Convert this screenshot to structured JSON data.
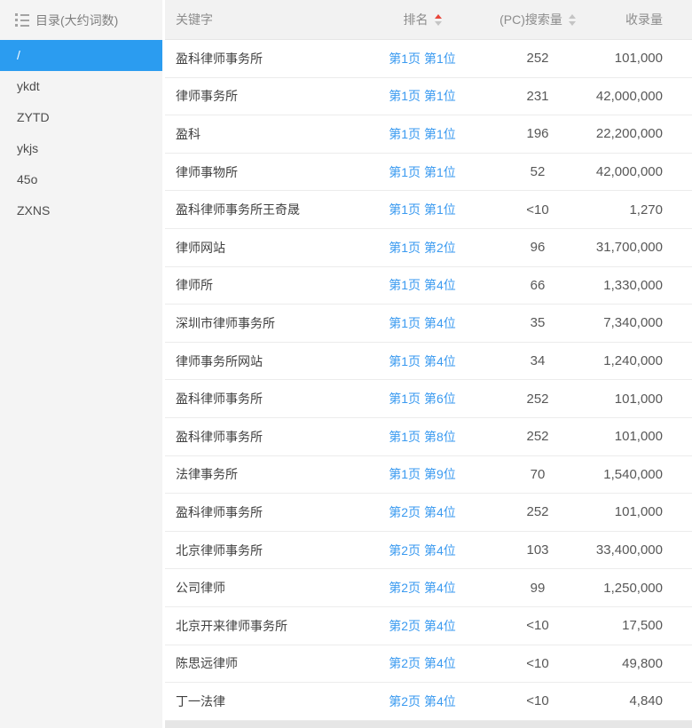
{
  "sidebar": {
    "header": {
      "label": "目录(大约词数)",
      "icon": "list-icon"
    },
    "items": [
      {
        "label": "/",
        "selected": true
      },
      {
        "label": "ykdt",
        "selected": false
      },
      {
        "label": "ZYTD",
        "selected": false
      },
      {
        "label": "ykjs",
        "selected": false
      },
      {
        "label": "45o",
        "selected": false
      },
      {
        "label": "ZXNS",
        "selected": false
      }
    ]
  },
  "table": {
    "columns": {
      "keyword": {
        "label": "关键字",
        "sortable": false
      },
      "rank": {
        "label": "排名",
        "sortable": true,
        "sort": "asc"
      },
      "pc": {
        "label": "(PC)搜索量",
        "sortable": true,
        "sort": "none"
      },
      "index": {
        "label": "收录量",
        "sortable": false
      }
    },
    "rows": [
      {
        "keyword": "盈科律师事务所",
        "rank": "第1页 第1位",
        "pc": "252",
        "index": "101,000"
      },
      {
        "keyword": "律师事务所",
        "rank": "第1页 第1位",
        "pc": "231",
        "index": "42,000,000"
      },
      {
        "keyword": "盈科",
        "rank": "第1页 第1位",
        "pc": "196",
        "index": "22,200,000"
      },
      {
        "keyword": "律师事物所",
        "rank": "第1页 第1位",
        "pc": "52",
        "index": "42,000,000"
      },
      {
        "keyword": "盈科律师事务所王奇晟",
        "rank": "第1页 第1位",
        "pc": "<10",
        "index": "1,270"
      },
      {
        "keyword": "律师网站",
        "rank": "第1页 第2位",
        "pc": "96",
        "index": "31,700,000"
      },
      {
        "keyword": "律师所",
        "rank": "第1页 第4位",
        "pc": "66",
        "index": "1,330,000"
      },
      {
        "keyword": "深圳市律师事务所",
        "rank": "第1页 第4位",
        "pc": "35",
        "index": "7,340,000"
      },
      {
        "keyword": "律师事务所网站",
        "rank": "第1页 第4位",
        "pc": "34",
        "index": "1,240,000"
      },
      {
        "keyword": "盈科律师事务所",
        "rank": "第1页 第6位",
        "pc": "252",
        "index": "101,000"
      },
      {
        "keyword": "盈科律师事务所",
        "rank": "第1页 第8位",
        "pc": "252",
        "index": "101,000"
      },
      {
        "keyword": "法律事务所",
        "rank": "第1页 第9位",
        "pc": "70",
        "index": "1,540,000"
      },
      {
        "keyword": "盈科律师事务所",
        "rank": "第2页 第4位",
        "pc": "252",
        "index": "101,000"
      },
      {
        "keyword": "北京律师事务所",
        "rank": "第2页 第4位",
        "pc": "103",
        "index": "33,400,000"
      },
      {
        "keyword": "公司律师",
        "rank": "第2页 第4位",
        "pc": "99",
        "index": "1,250,000"
      },
      {
        "keyword": "北京开来律师事务所",
        "rank": "第2页 第4位",
        "pc": "<10",
        "index": "17,500"
      },
      {
        "keyword": "陈思远律师",
        "rank": "第2页 第4位",
        "pc": "<10",
        "index": "49,800"
      },
      {
        "keyword": "丁一法律",
        "rank": "第2页 第4位",
        "pc": "<10",
        "index": "4,840"
      }
    ]
  },
  "colors": {
    "selected_item_bg": "#2b9cf0",
    "link_blue": "#3a9af0",
    "sort_active_red": "#e8473b",
    "sort_inactive_gray": "#c4c4c4",
    "sidebar_bg": "#f4f4f4",
    "table_header_bg": "#f2f2f2"
  }
}
